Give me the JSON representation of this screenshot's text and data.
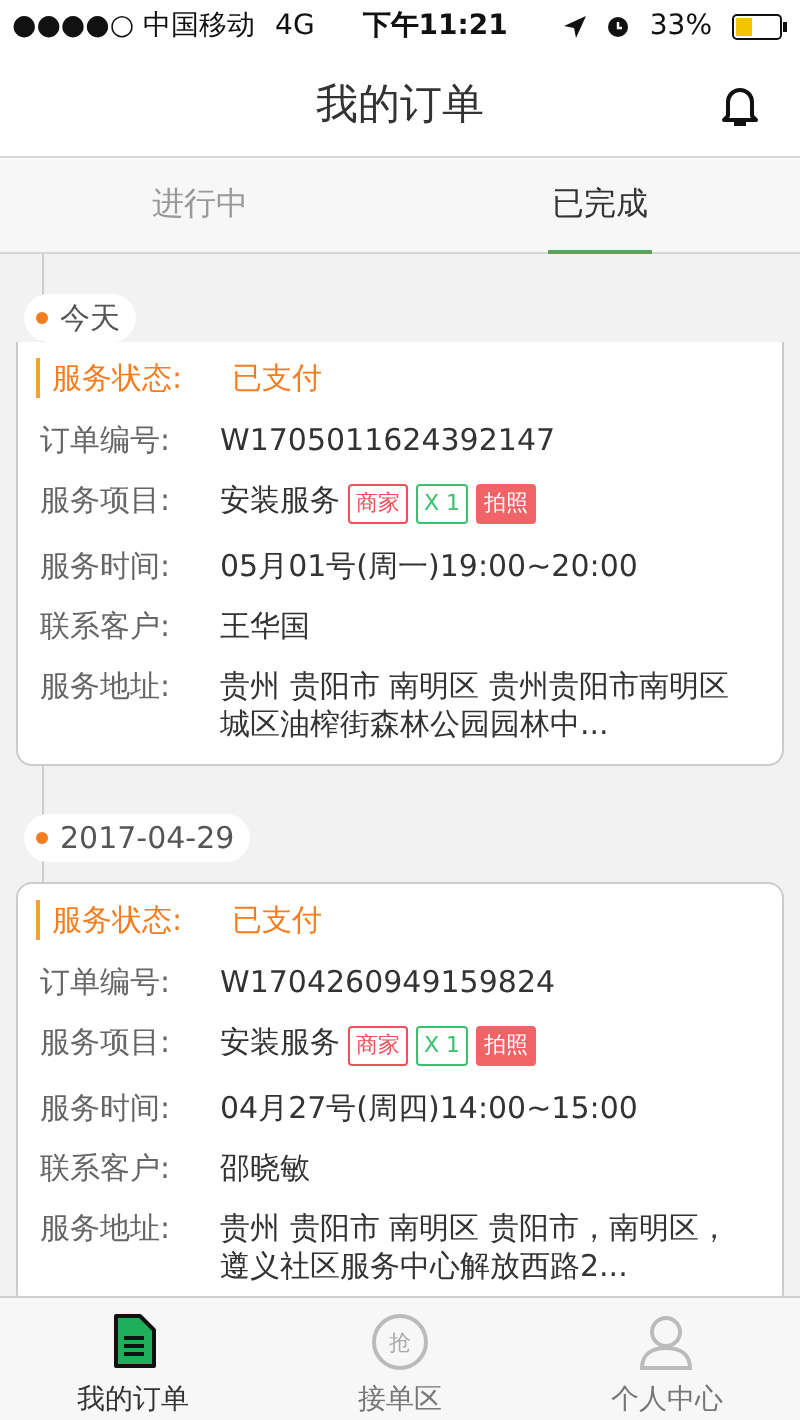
{
  "status_bar": {
    "carrier": "●●●●○ 中国移动",
    "network": "4G",
    "time": "下午11:21",
    "battery": "33%"
  },
  "header": {
    "title": "我的订单"
  },
  "tabs": [
    {
      "label": "进行中",
      "selected": false
    },
    {
      "label": "已完成",
      "selected": true
    }
  ],
  "groups": [
    {
      "date": "今天",
      "orders": [
        {
          "status_label": "服务状态:",
          "status": "已支付",
          "fields": [
            {
              "label": "订单编号:",
              "value": "W1705011624392147"
            },
            {
              "label": "服务项目:",
              "value": "安装服务",
              "tags": [
                {
                  "text": "商家",
                  "kind": "outline",
                  "color": "#f0505a"
                },
                {
                  "text": "X 1",
                  "kind": "outline",
                  "color": "#3cbf6e"
                },
                {
                  "text": "拍照",
                  "kind": "filled",
                  "color": "#f06468"
                }
              ]
            },
            {
              "label": "服务时间:",
              "value": "05月01号(周一)19:00~20:00"
            },
            {
              "label": "联系客户:",
              "value": "王华国"
            },
            {
              "label": "服务地址:",
              "value": "贵州 贵阳市 南明区  贵州贵阳市南明区城区油榨街森林公园园林中..."
            }
          ]
        }
      ]
    },
    {
      "date": "2017-04-29",
      "orders": [
        {
          "status_label": "服务状态:",
          "status": "已支付",
          "fields": [
            {
              "label": "订单编号:",
              "value": "W1704260949159824"
            },
            {
              "label": "服务项目:",
              "value": "安装服务",
              "tags": [
                {
                  "text": "商家",
                  "kind": "outline",
                  "color": "#f0505a"
                },
                {
                  "text": "X 1",
                  "kind": "outline",
                  "color": "#3cbf6e"
                },
                {
                  "text": "拍照",
                  "kind": "filled",
                  "color": "#f06468"
                }
              ]
            },
            {
              "label": "服务时间:",
              "value": "04月27号(周四)14:00~15:00"
            },
            {
              "label": "联系客户:",
              "value": "邵晓敏"
            },
            {
              "label": "服务地址:",
              "value": "贵州 贵阳市 南明区  贵阳市，南明区，遵义社区服务中心解放西路2..."
            }
          ]
        }
      ]
    }
  ],
  "nav": [
    {
      "label": "我的订单",
      "kind": "doc",
      "selected": true
    },
    {
      "label": "接单区",
      "kind": "grab",
      "icon_text": "抢",
      "selected": false
    },
    {
      "label": "个人中心",
      "kind": "person",
      "selected": false
    }
  ]
}
